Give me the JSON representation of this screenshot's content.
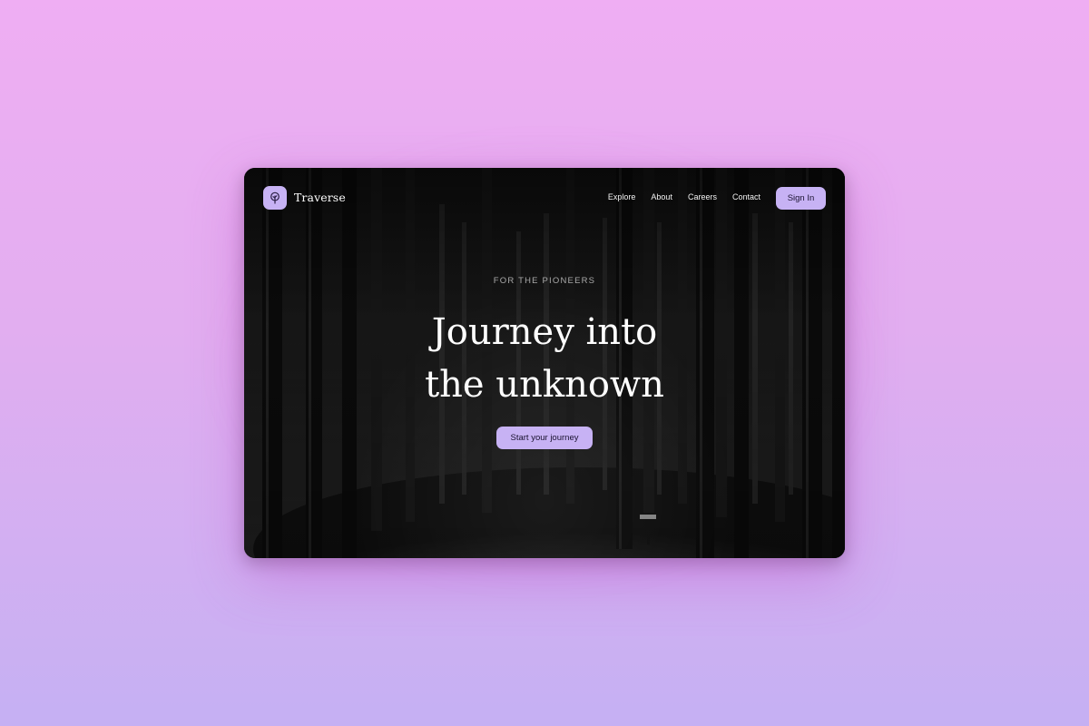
{
  "brand": {
    "name": "Traverse",
    "logo_icon": "tree-icon"
  },
  "nav": {
    "links": [
      "Explore",
      "About",
      "Careers",
      "Contact"
    ],
    "signin_label": "Sign In"
  },
  "hero": {
    "eyebrow": "FOR THE PIONEERS",
    "headline_line1": "Journey into",
    "headline_line2": "the unknown",
    "cta_label": "Start your journey"
  },
  "colors": {
    "accent": "#c7b2f4",
    "background_top": "#efaef3",
    "background_bottom": "#c5b0f3",
    "window_bg": "#0b0b0b"
  }
}
